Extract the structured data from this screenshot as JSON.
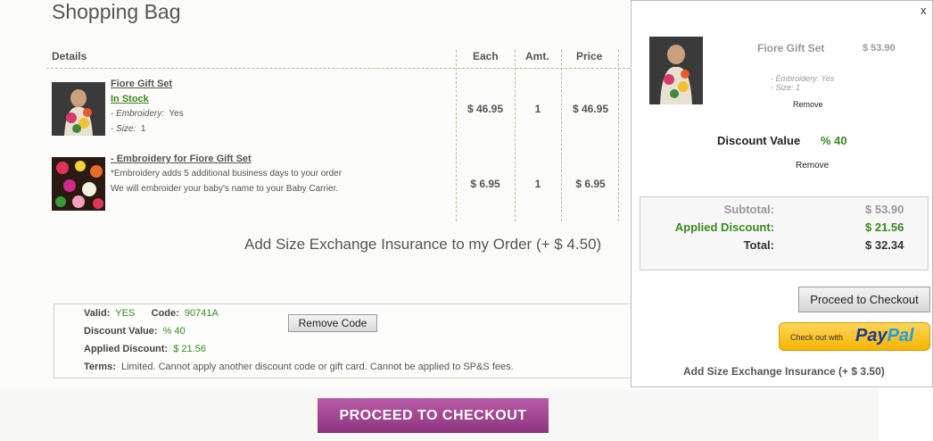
{
  "page_title": "Shopping Bag",
  "table": {
    "headers": {
      "details": "Details",
      "each": "Each",
      "amt": "Amt.",
      "price": "Price"
    },
    "items": [
      {
        "name": "Fiore Gift Set",
        "stock": "In Stock",
        "embroidery_label": "- Embroidery:",
        "embroidery_value": "Yes",
        "size_label": "- Size:",
        "size_value": "1",
        "each": "$ 46.95",
        "amt": "1",
        "price": "$ 46.95"
      },
      {
        "name": "- Embroidery for Fiore Gift Set",
        "note1": "*Embroidery adds 5 additional business days to your order",
        "note2": "We will embroider your baby's name to your Baby Carrier.",
        "each": "$ 6.95",
        "amt": "1",
        "price": "$ 6.95"
      }
    ]
  },
  "insurance_text": "Add Size Exchange Insurance to my Order (+ $ 4.50)",
  "coupon": {
    "valid_label": "Valid:",
    "valid_value": "YES",
    "code_label": "Code:",
    "code_value": "90741A",
    "discount_label": "Discount Value:",
    "discount_value": "% 40",
    "applied_label": "Applied Discount:",
    "applied_value": "$ 21.56",
    "terms_label": "Terms:",
    "terms_value": "Limited. Cannot apply another discount code or gift card. Cannot be applied to SP&S fees.",
    "remove_button": "Remove Code"
  },
  "checkout_button": "PROCEED TO CHECKOUT",
  "mini_cart": {
    "close": "x",
    "item_name": "Fiore Gift Set",
    "item_price": "$ 53.90",
    "embroidery": "- Embroidery:  Yes",
    "size": "- Size:  1",
    "remove_item": "Remove",
    "discount_label": "Discount Value",
    "discount_value": "% 40",
    "remove_discount": "Remove",
    "subtotal_label": "Subtotal:",
    "subtotal_value": "$ 53.90",
    "applied_label": "Applied Discount:",
    "applied_value": "$ 21.56",
    "total_label": "Total:",
    "total_value": "$ 32.34",
    "checkout_button": "Proceed  to Checkout",
    "paypal_small": "Check out with",
    "paypal_pay": "Pay",
    "paypal_pal": "Pal",
    "insurance": "Add Size Exchange Insurance (+ $ 3.50)"
  },
  "colors": {
    "green": "#3a8a1f",
    "checkout_purple": "#a0478f",
    "paypal_yellow": "#f7c33a"
  }
}
